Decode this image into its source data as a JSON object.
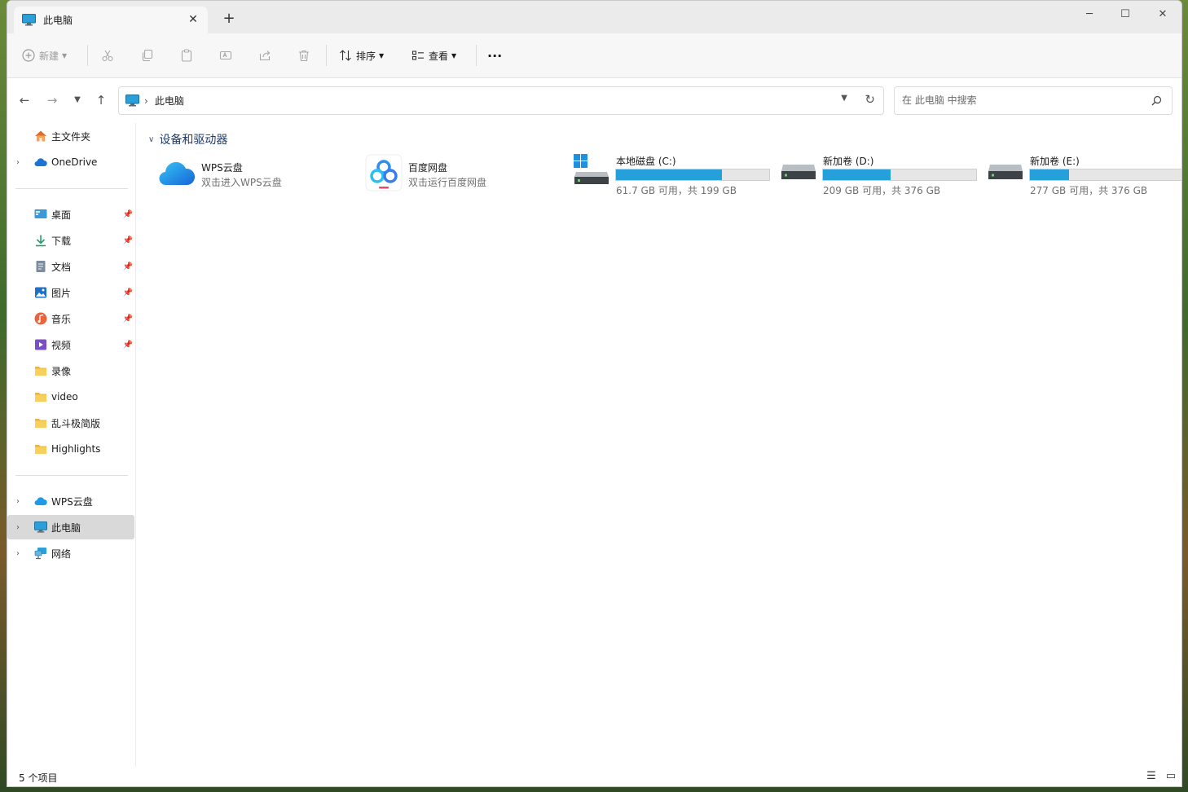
{
  "window": {
    "tab_title": "此电脑",
    "tab_close": "✕",
    "new_tab": "+",
    "minimize": "─",
    "maximize": "☐",
    "close": "✕"
  },
  "toolbar": {
    "new_label": "新建",
    "sort_label": "排序",
    "view_label": "查看",
    "more": "···"
  },
  "address": {
    "crumb": "此电脑",
    "search_placeholder": "在 此电脑 中搜索"
  },
  "sidebar": {
    "home": "主文件夹",
    "onedrive": "OneDrive",
    "quick": [
      {
        "label": "桌面",
        "icon": "desktop-icon"
      },
      {
        "label": "下载",
        "icon": "download-icon"
      },
      {
        "label": "文档",
        "icon": "document-icon"
      },
      {
        "label": "图片",
        "icon": "picture-icon"
      },
      {
        "label": "音乐",
        "icon": "music-icon"
      },
      {
        "label": "视频",
        "icon": "video-icon"
      },
      {
        "label": "录像",
        "icon": "folder-icon"
      },
      {
        "label": "video",
        "icon": "folder-icon"
      },
      {
        "label": "乱斗极简版",
        "icon": "folder-icon"
      },
      {
        "label": "Highlights",
        "icon": "folder-icon"
      }
    ],
    "wps": "WPS云盘",
    "this_pc": "此电脑",
    "network": "网络"
  },
  "main": {
    "group_title": "设备和驱动器",
    "locations": [
      {
        "name": "WPS云盘",
        "desc": "双击进入WPS云盘"
      },
      {
        "name": "百度网盘",
        "desc": "双击运行百度网盘"
      }
    ],
    "drives": [
      {
        "name": "本地磁盘 (C:)",
        "info": "61.7 GB 可用，共 199 GB",
        "used_fraction": 0.69
      },
      {
        "name": "新加卷 (D:)",
        "info": "209 GB 可用，共 376 GB",
        "used_fraction": 0.44
      },
      {
        "name": "新加卷 (E:)",
        "info": "277 GB 可用，共 376 GB",
        "used_fraction": 0.26
      }
    ]
  },
  "status": {
    "item_count": "5 个项目"
  },
  "colors": {
    "accent": "#26a0da",
    "selected": "#d9d9d9",
    "folder": "#f2c744"
  }
}
